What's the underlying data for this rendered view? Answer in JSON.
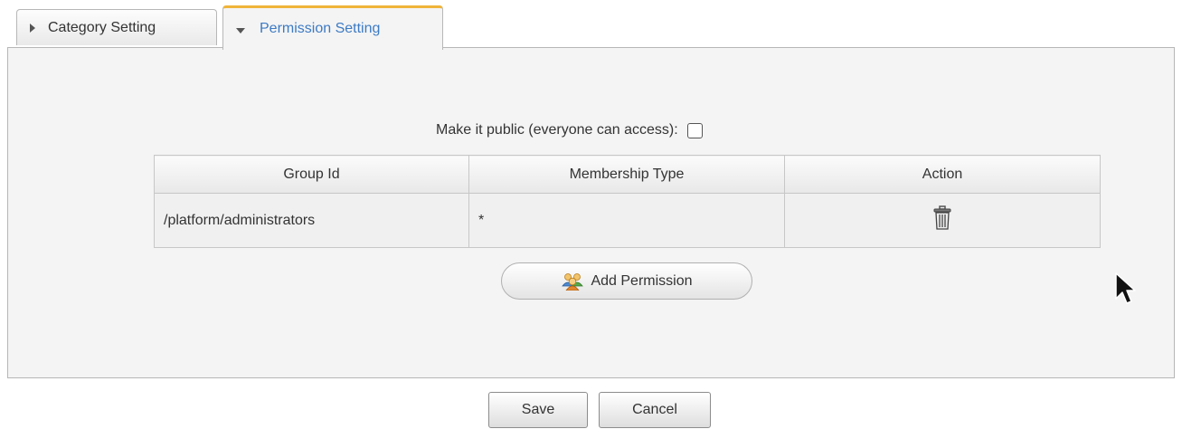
{
  "tabs": [
    {
      "label": "Category Setting",
      "state": "collapsed",
      "icon": "triangle-right-icon"
    },
    {
      "label": "Permission Setting",
      "state": "expanded",
      "icon": "triangle-down-icon"
    }
  ],
  "permission": {
    "public_label": "Make it public (everyone can access):",
    "public_checked": false,
    "table": {
      "headers": [
        "Group Id",
        "Membership Type",
        "Action"
      ],
      "rows": [
        {
          "group_id": "/platform/administrators",
          "membership_type": "*",
          "action_icon": "trash-icon"
        }
      ]
    },
    "add_button_label": "Add Permission",
    "add_button_icon": "users-group-icon"
  },
  "footer": {
    "save_label": "Save",
    "cancel_label": "Cancel"
  },
  "colors": {
    "active_tab_accent": "#f0b43a",
    "active_tab_text": "#3d7bc4",
    "panel_background": "#f4f4f4"
  }
}
